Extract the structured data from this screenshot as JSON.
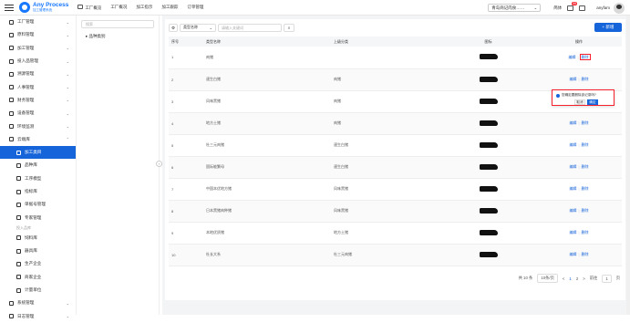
{
  "header": {
    "logo_title": "Any Process",
    "logo_sub": "加工管理系统",
    "nav": [
      "工厂概览",
      "工厂概况",
      "加工指示",
      "加工跟踪",
      "订单管理"
    ],
    "org_select": "青岛商记肉食……",
    "notif_count": "99",
    "lang": "简体",
    "user": "anyfam"
  },
  "sidebar": {
    "items": [
      {
        "label": "工厂管理",
        "icon": "factory-icon"
      },
      {
        "label": "原料管理",
        "icon": "tools-icon"
      },
      {
        "label": "加工管理",
        "icon": "wrench-icon"
      },
      {
        "label": "投入品管理",
        "icon": "input-icon"
      },
      {
        "label": "溯源管理",
        "icon": "trace-icon"
      },
      {
        "label": "人事管理",
        "icon": "person-icon"
      },
      {
        "label": "财务管理",
        "icon": "finance-icon"
      },
      {
        "label": "设备管理",
        "icon": "device-icon"
      },
      {
        "label": "环境监测",
        "icon": "env-icon"
      },
      {
        "label": "云端库",
        "icon": "cloud-icon"
      }
    ],
    "sub_items": [
      {
        "label": "加工类目",
        "icon": "category-icon",
        "active": true
      },
      {
        "label": "品种库",
        "icon": "breed-icon"
      },
      {
        "label": "工序模型",
        "icon": "process-icon"
      },
      {
        "label": "指标库",
        "icon": "flag-icon"
      },
      {
        "label": "单据号管理",
        "icon": "doc-icon"
      },
      {
        "label": "专家管理",
        "icon": "expert-icon"
      }
    ],
    "group_label": "投入品库",
    "group_items": [
      {
        "label": "饲料库",
        "icon": "feed-icon"
      },
      {
        "label": "器具库",
        "icon": "tool-icon"
      },
      {
        "label": "生产企业",
        "icon": "enterprise-icon"
      },
      {
        "label": "商家企业",
        "icon": "shop-icon"
      },
      {
        "label": "计量单位",
        "icon": "unit-icon"
      }
    ],
    "tail_items": [
      {
        "label": "系统管理",
        "icon": "system-icon"
      },
      {
        "label": "日志管理",
        "icon": "log-icon"
      }
    ]
  },
  "tree": {
    "search_placeholder": "搜索",
    "node": "品种类别"
  },
  "toolbar": {
    "settings": "⚙",
    "select": "类型名称",
    "input_placeholder": "请输入关键词",
    "search": "⌕",
    "add": "+ 新增"
  },
  "table": {
    "headers": [
      "序号",
      "类型名称",
      "上级分类",
      "图标",
      "操作"
    ],
    "rows": [
      [
        "1",
        "肉猪",
        "",
        "编辑",
        "删除"
      ],
      [
        "2",
        "速生白猪",
        "肉猪",
        "编辑",
        "删除"
      ],
      [
        "3",
        "风味黑猪",
        "肉猪",
        "编辑",
        "删除"
      ],
      [
        "4",
        "地方土猪",
        "肉猪",
        "编辑",
        "删除"
      ],
      [
        "5",
        "杜三元肉猪",
        "速生白猪",
        "编辑",
        "删除"
      ],
      [
        "6",
        "国际能繁母",
        "速生白猪",
        "编辑",
        "删除"
      ],
      [
        "7",
        "中国本优地方猪",
        "风味黑猪",
        "编辑",
        "删除"
      ],
      [
        "8",
        "日本黑猪肉种猪",
        "风味黑猪",
        "编辑",
        "删除"
      ],
      [
        "9",
        "本地优质猪",
        "地方土猪",
        "编辑",
        "删除"
      ],
      [
        "10",
        "杜长大系",
        "杜三元肉猪",
        "编辑",
        "删除"
      ]
    ]
  },
  "popconfirm": {
    "message": "您确定要删除该记录吗?",
    "cancel": "取消",
    "ok": "确定"
  },
  "pager": {
    "total": "共 10 条",
    "size": "10条/页",
    "prev": "<",
    "page1": "1",
    "page2": "2",
    "next": ">",
    "goto": "前往",
    "page_input": "1",
    "page_unit": "页"
  }
}
